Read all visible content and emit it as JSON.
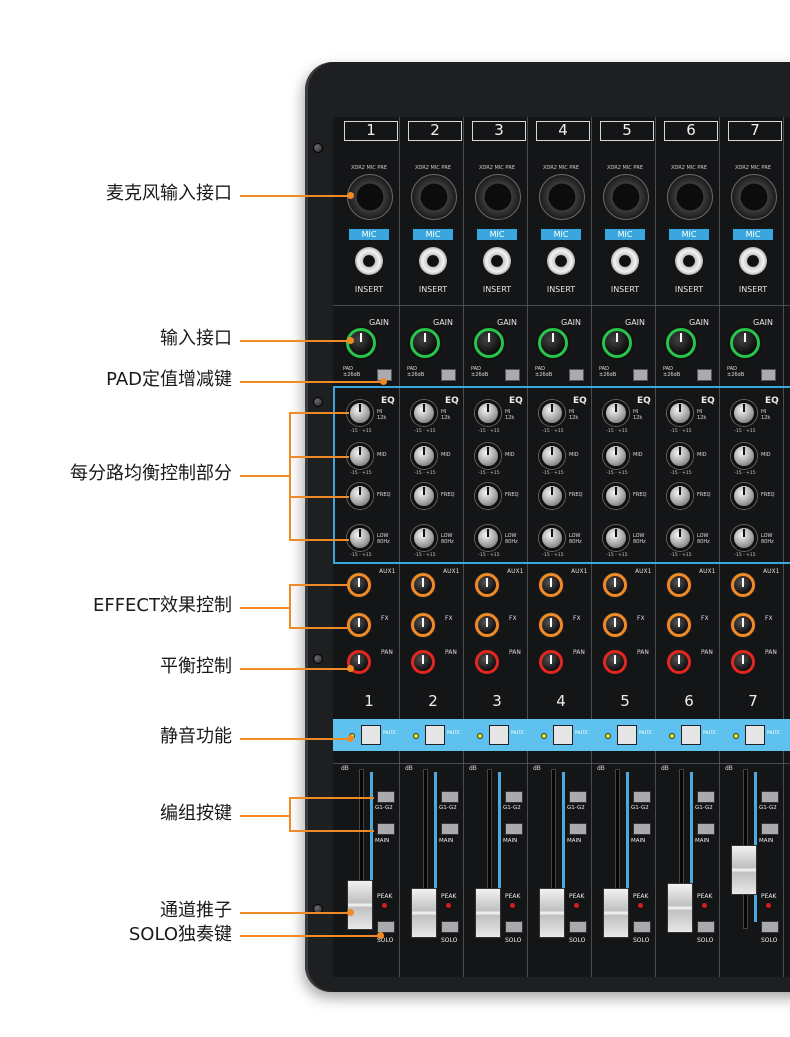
{
  "callouts": [
    {
      "label": "麦克风输入接口"
    },
    {
      "label": "输入接口"
    },
    {
      "label": "PAD定值增减键"
    },
    {
      "label": "每分路均衡控制部分"
    },
    {
      "label": "EFFECT效果控制"
    },
    {
      "label": "平衡控制"
    },
    {
      "label": "静音功能"
    },
    {
      "label": "编组按键"
    },
    {
      "label": "通道推子"
    },
    {
      "label": "SOLO独奏键"
    }
  ],
  "channels": [
    {
      "number": "1",
      "bottom_number": "1"
    },
    {
      "number": "2",
      "bottom_number": "2"
    },
    {
      "number": "3",
      "bottom_number": "3"
    },
    {
      "number": "4",
      "bottom_number": "4"
    },
    {
      "number": "5",
      "bottom_number": "5"
    },
    {
      "number": "6",
      "bottom_number": "6"
    },
    {
      "number": "7",
      "bottom_number": "7"
    }
  ],
  "strip_labels": {
    "xlr_caption": "XDR2 MIC PRE",
    "mic": "MIC",
    "insert": "INSERT",
    "gain": "GAIN",
    "pad": "PAD\n±26dB",
    "eq": "EQ",
    "hi": "HI\n12k",
    "mid": "MID",
    "freq": "FREQ",
    "low": "LOW\n80Hz",
    "eq_scale": "-15 · +15",
    "aux1": "AUX1",
    "fx": "FX",
    "pan": "PAN",
    "mute": "MUTE",
    "group": "G1-G2",
    "main": "MAIN",
    "peak": "PEAK",
    "solo": "SOLO",
    "db": "dB"
  },
  "colors": {
    "accent_orange": "#f08a24",
    "gain_ring": "#29c24a",
    "pan_ring": "#e2271e",
    "mic_badge": "#3aa6dd",
    "mute_strip": "#5fc2ee"
  }
}
